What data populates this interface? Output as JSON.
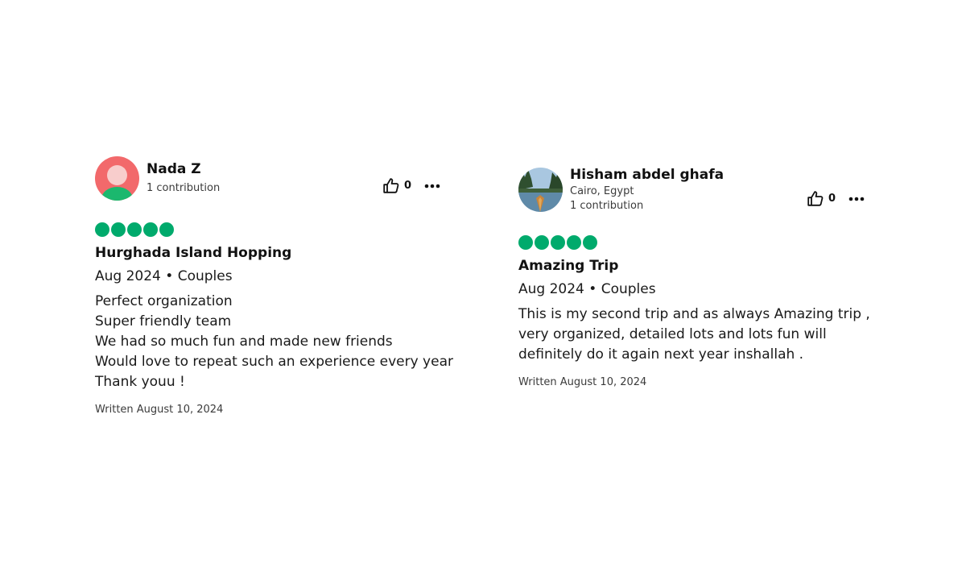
{
  "colors": {
    "rating": "#00aa6c",
    "avatar_bg": "#f2696b",
    "avatar_head": "#f8cdcc",
    "avatar_body": "#1bb86e"
  },
  "reviews": [
    {
      "user": {
        "name": "Nada Z",
        "location": "",
        "contributions": "1 contribution",
        "avatar": "default-avatar-icon"
      },
      "likes": "0",
      "rating": 5,
      "title": "Hurghada Island Hopping",
      "trip": "Aug 2024 • Couples",
      "body": [
        "Perfect organization",
        "Super friendly team",
        "We had so much fun and made new friends",
        "Would love to repeat such an experience every year",
        "Thank youu !"
      ],
      "written": "Written August 10, 2024"
    },
    {
      "user": {
        "name": "Hisham abdel ghafa",
        "location": "Cairo, Egypt",
        "contributions": "1 contribution",
        "avatar": "lake-photo-avatar"
      },
      "likes": "0",
      "rating": 5,
      "title": "Amazing Trip",
      "trip": "Aug 2024 • Couples",
      "body": [
        "This is my second trip and as always Amazing trip ,",
        "very organized, detailed lots and lots fun will",
        "definitely do it again next year inshallah ."
      ],
      "written": "Written August 10, 2024"
    }
  ]
}
